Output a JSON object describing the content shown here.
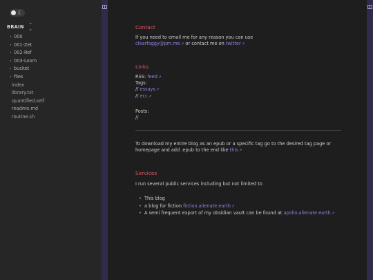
{
  "sidebar": {
    "vault_name": "BRAIN",
    "tree": [
      {
        "label": "000",
        "type": "folder"
      },
      {
        "label": "001-Zet",
        "type": "folder"
      },
      {
        "label": "002-Ref",
        "type": "folder"
      },
      {
        "label": "003-Loom",
        "type": "folder"
      },
      {
        "label": "bucket",
        "type": "folder"
      },
      {
        "label": "files",
        "type": "folder"
      },
      {
        "label": "index",
        "type": "file"
      },
      {
        "label": "library.txt",
        "type": "file"
      },
      {
        "label": "quantified.self",
        "type": "file"
      },
      {
        "label": "readme.md",
        "type": "file"
      },
      {
        "label": "routine.sh",
        "type": "file"
      }
    ]
  },
  "content": {
    "contact_heading": "Contact",
    "contact_text1": "If you need to email me for any reason you can use",
    "contact_email": "clearfoggy@pm.me",
    "contact_text2": "or contact me on",
    "contact_twitter": "twitter",
    "links_heading": "Links",
    "rss_label": "RSS:",
    "rss_link": "feed",
    "tags_label": "Tags:",
    "tag1_prefix": "//",
    "tag1_link": "essays",
    "tag2_prefix": "//",
    "tag2_link": "ecc",
    "posts_label": "Posts:",
    "posts_prefix": "//",
    "download_text": "To download my entire blog as an epub or a specific tag go to the desired tag page or homepage and add .epub to the end like",
    "download_link": "this",
    "services_heading": "Services",
    "services_intro": "I run several public services including but not limited to",
    "services_items": [
      {
        "text": "This blog",
        "link": ""
      },
      {
        "text": "a blog for fiction",
        "link": "fiction.alienate.earth"
      },
      {
        "text": "A semi frequent export of my obsidian vault can be found at",
        "link": "apollo.alienate.earth"
      }
    ]
  },
  "colors": {
    "heading": "#e0566a",
    "link": "#8f82e0",
    "gutter": "#2f2c4a",
    "background": "#1e1e1e"
  },
  "icons": {
    "theme_toggle": "theme-toggle-icon",
    "moon": "moon-icon",
    "sort": "chevron-up-down-icon",
    "folder_arrow": "chevron-right-icon",
    "external": "external-link-icon",
    "sidebar_toggle": "sidebar-toggle-icon"
  }
}
